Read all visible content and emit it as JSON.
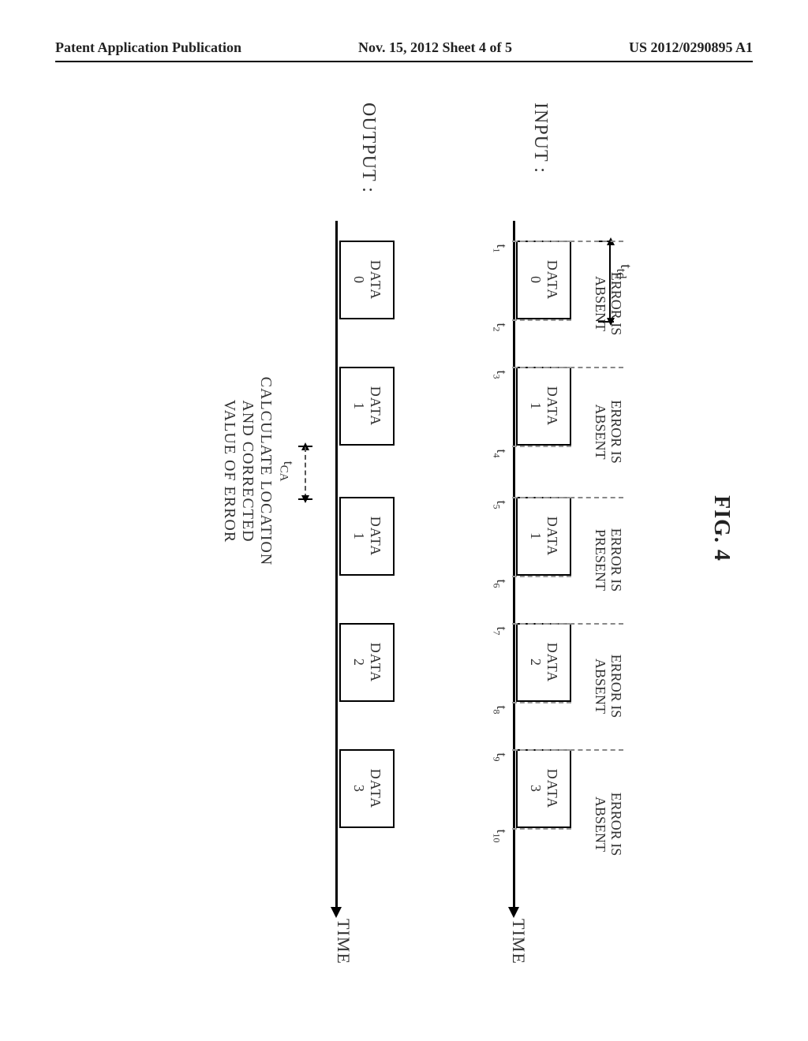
{
  "header": {
    "left": "Patent Application Publication",
    "center": "Nov. 15, 2012  Sheet 4 of 5",
    "right": "US 2012/0290895 A1"
  },
  "figure_title": "FIG. 4",
  "row_labels": {
    "input": "INPUT :",
    "output": "OUTPUT :"
  },
  "axis_label": "TIME",
  "data_word": "DATA",
  "error_present": "ERROR IS\nPRESENT",
  "error_absent": "ERROR IS\nABSENT",
  "td_label": "t_td",
  "tca_label": "t_CA",
  "calc_text": "CALCULATE LOCATION\nAND CORRECTED\nVALUE OF ERROR",
  "chart_data": {
    "type": "timeline",
    "ticks": [
      "t1",
      "t2",
      "t3",
      "t4",
      "t5",
      "t6",
      "t7",
      "t8",
      "t9",
      "t10"
    ],
    "input_blocks": [
      {
        "label": 0,
        "start": "t1",
        "end": "t2"
      },
      {
        "label": 1,
        "start": "t3",
        "end": "t4"
      },
      {
        "label": 1,
        "start": "t5",
        "end": "t6"
      },
      {
        "label": 2,
        "start": "t7",
        "end": "t8"
      },
      {
        "label": 3,
        "start": "t9",
        "end": "t10"
      }
    ],
    "output_blocks": [
      {
        "label": 0,
        "start": "t1",
        "end": "t2"
      },
      {
        "label": 1,
        "start": "t3",
        "end": "t4"
      },
      {
        "label": 1,
        "start": "t5",
        "end": "t6"
      },
      {
        "label": 2,
        "start": "t7",
        "end": "t8"
      },
      {
        "label": 3,
        "start": "t9",
        "end": "t10"
      }
    ],
    "td_span": {
      "from": "t1_left_edge",
      "to": "t2"
    },
    "error_state": {
      "t1-t3": "absent",
      "t3-t5": "absent",
      "t5-t7": "present",
      "t7-t9": "absent",
      "t9-t10": "absent"
    },
    "tca_span": {
      "from": "t4",
      "to": "t5"
    }
  },
  "layout": {
    "x": {
      "t1": 175,
      "t2": 275,
      "t3": 335,
      "t4": 435,
      "t5": 500,
      "t6": 600,
      "t7": 660,
      "t8": 760,
      "t9": 820,
      "t10": 920
    },
    "group_edges": [
      175,
      335,
      500,
      660,
      820
    ]
  }
}
